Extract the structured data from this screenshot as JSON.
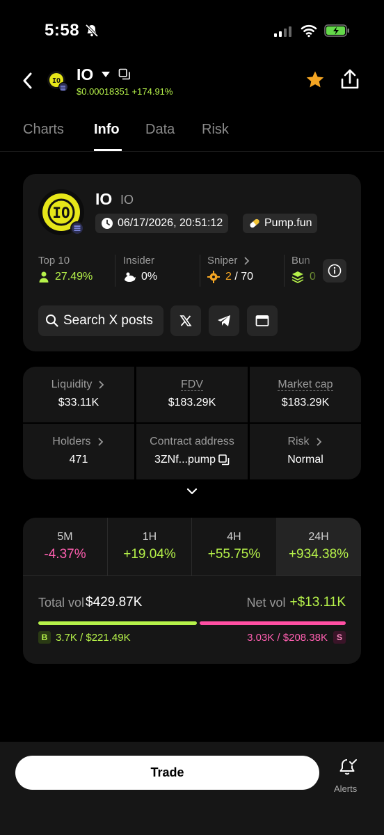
{
  "status": {
    "time": "5:58"
  },
  "header": {
    "title": "IO",
    "price": "$0.00018351",
    "change": "+174.91%"
  },
  "tabs": [
    {
      "label": "Charts"
    },
    {
      "label": "Info"
    },
    {
      "label": "Data"
    },
    {
      "label": "Risk"
    }
  ],
  "token": {
    "name": "IO",
    "ticker": "IO",
    "logo_text": "IO",
    "created": "06/17/2026, 20:51:12",
    "launchpad": "Pump.fun"
  },
  "holders_metrics": {
    "top10": {
      "label": "Top 10",
      "value": "27.49%"
    },
    "insider": {
      "label": "Insider",
      "value": "0%"
    },
    "sniper": {
      "label": "Sniper",
      "value": "2",
      "total": "/ 70"
    },
    "bundle": {
      "label": "Bun",
      "value": "0"
    }
  },
  "actions": {
    "search": "Search X posts"
  },
  "stats": {
    "liquidity": {
      "label": "Liquidity",
      "value": "$33.11K"
    },
    "fdv": {
      "label": "FDV",
      "value": "$183.29K"
    },
    "market_cap": {
      "label": "Market cap",
      "value": "$183.29K"
    },
    "holders": {
      "label": "Holders",
      "value": "471"
    },
    "contract": {
      "label": "Contract address",
      "value": "3ZNf...pump"
    },
    "risk": {
      "label": "Risk",
      "value": "Normal"
    }
  },
  "changes": [
    {
      "label": "5M",
      "value": "-4.37%"
    },
    {
      "label": "1H",
      "value": "+19.04%"
    },
    {
      "label": "4H",
      "value": "+55.75%"
    },
    {
      "label": "24H",
      "value": "+934.38%"
    }
  ],
  "volume": {
    "total_label": "Total vol",
    "total_value": "$429.87K",
    "net_label": "Net vol",
    "net_value": "+$13.11K",
    "buy_tag": "B",
    "buy": "3.7K / $221.49K",
    "sell": "3.03K / $208.38K",
    "sell_tag": "S",
    "buy_share": 0.515
  },
  "bottom": {
    "trade": "Trade",
    "alerts": "Alerts"
  },
  "colors": {
    "positive": "#b6f24a",
    "negative": "#ff5fb0",
    "star": "#f5a623"
  }
}
